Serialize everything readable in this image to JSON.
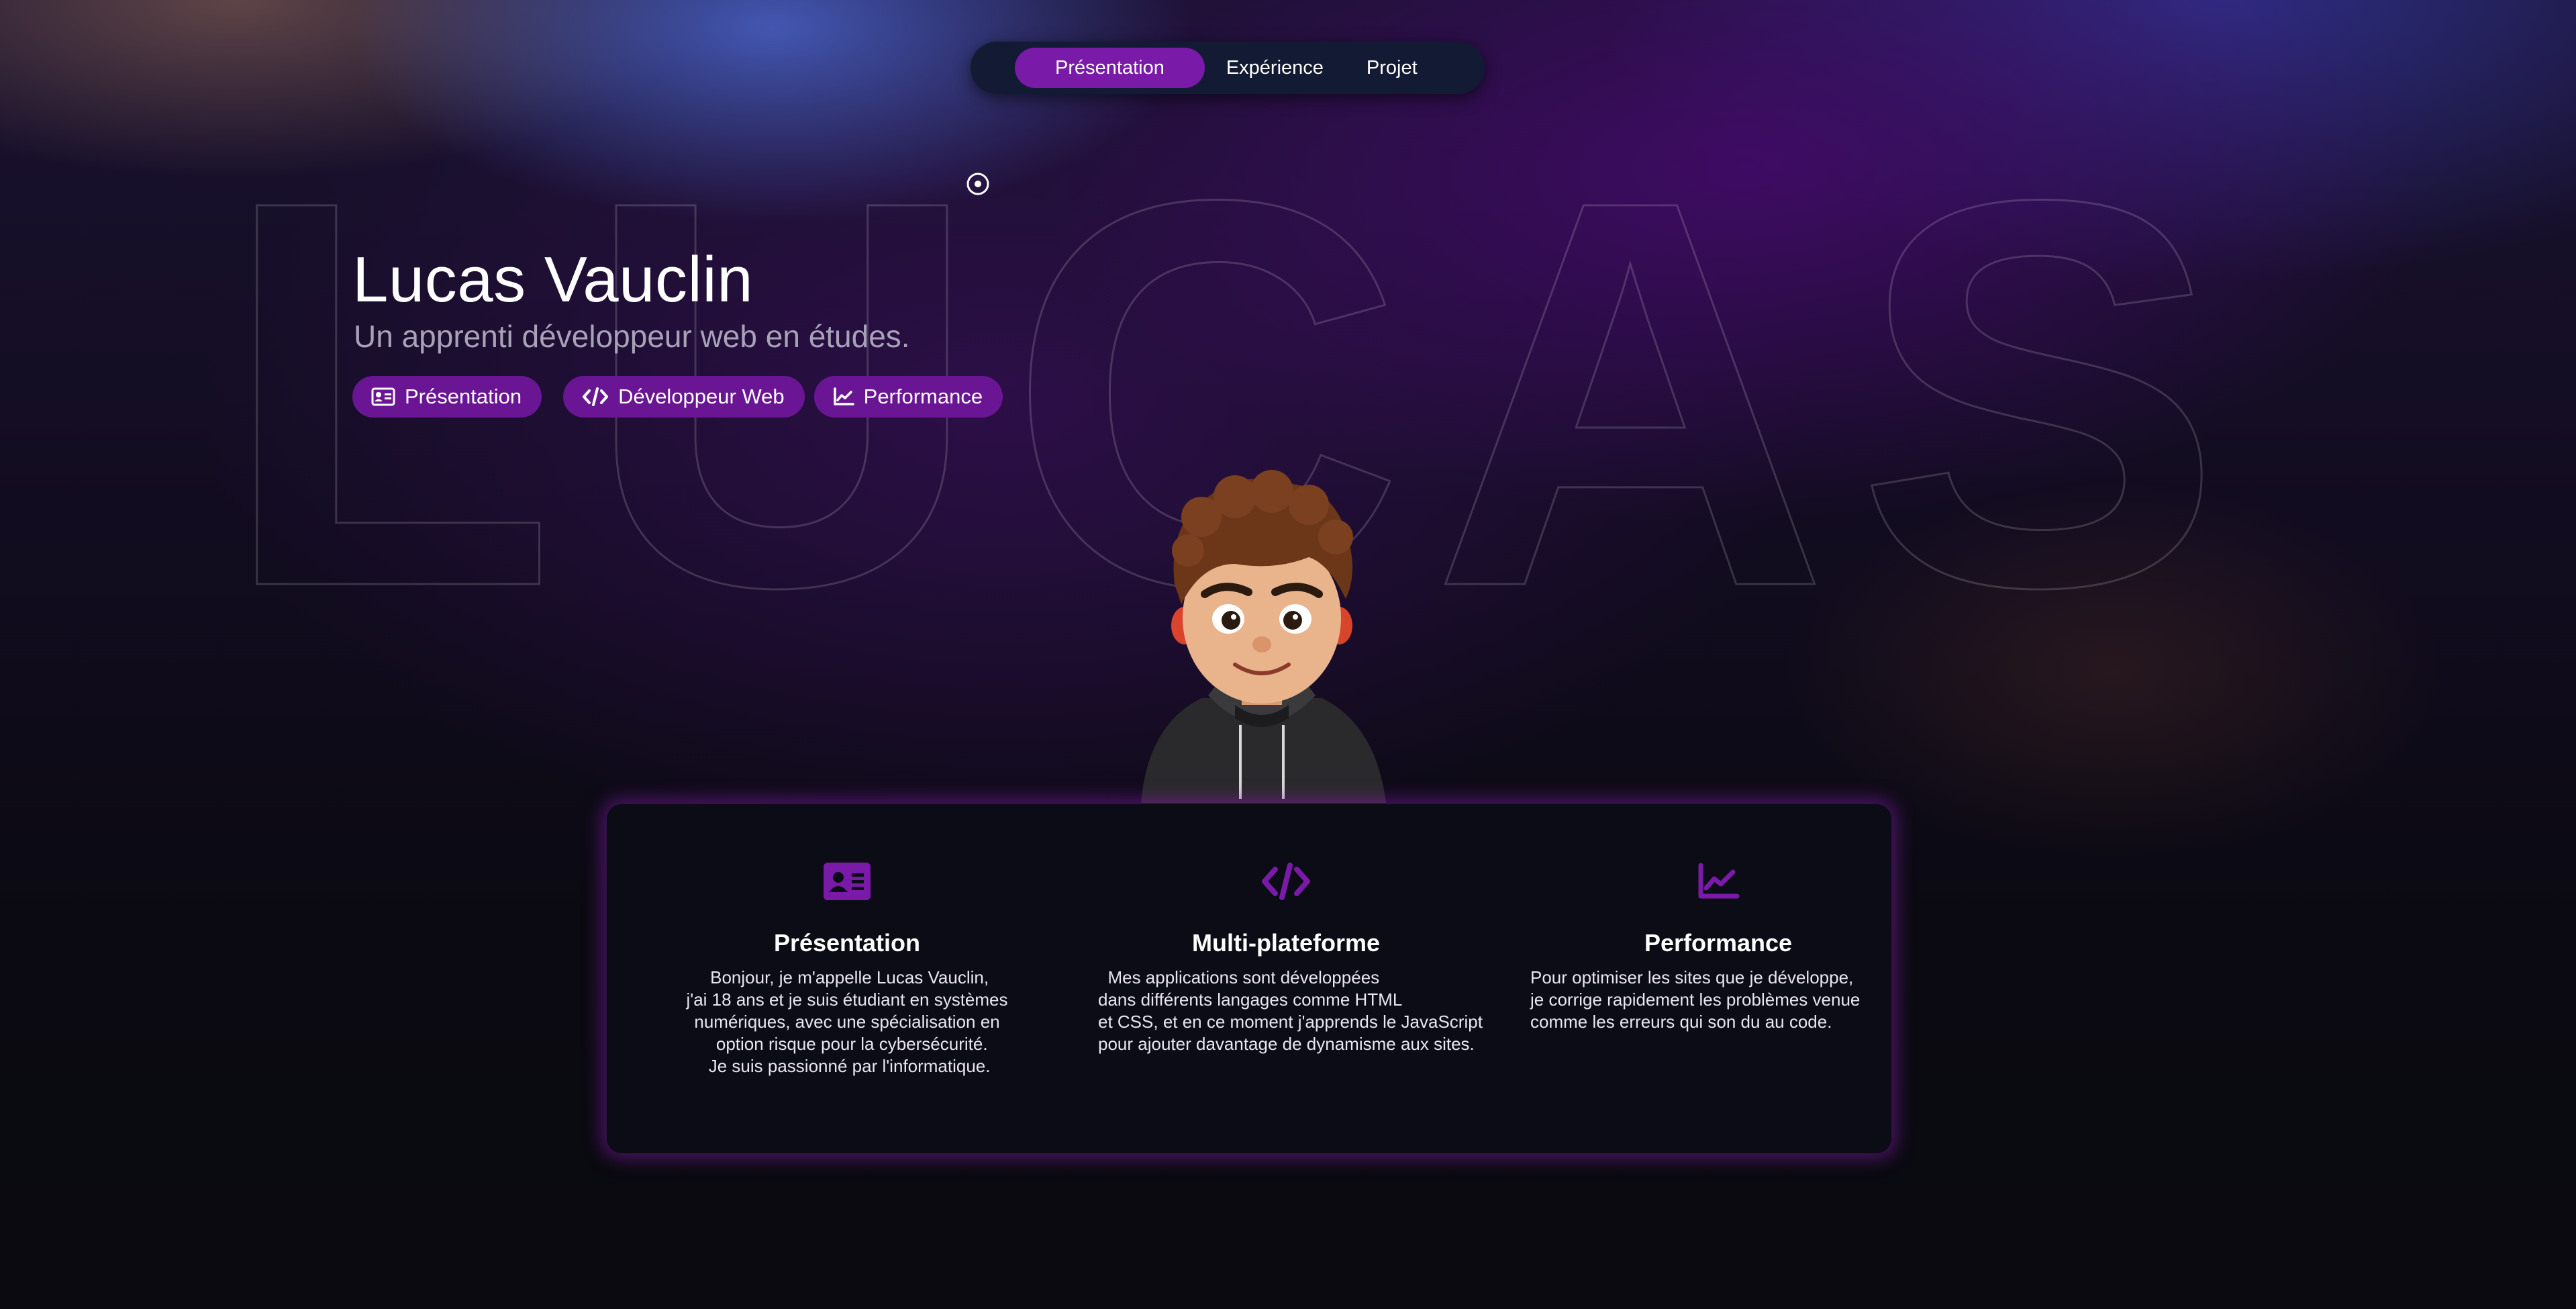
{
  "nav": {
    "items": [
      {
        "label": "Présentation",
        "active": true
      },
      {
        "label": "Expérience",
        "active": false
      },
      {
        "label": "Projet",
        "active": false
      }
    ]
  },
  "background_word": "LUCAS",
  "hero": {
    "name": "Lucas Vauclin",
    "subtitle": "Un apprenti développeur web en études.",
    "pills": [
      {
        "label": "Présentation",
        "icon": "id-card-icon"
      },
      {
        "label": "Développeur Web",
        "icon": "code-icon"
      },
      {
        "label": "Performance",
        "icon": "chart-line-icon"
      }
    ]
  },
  "features": [
    {
      "icon": "id-card-icon",
      "title": "Présentation",
      "text": " Bonjour, je m'appelle Lucas Vauclin,\nj'ai 18 ans et je suis étudiant en systèmes\nnumériques, avec une spécialisation en\n  option risque pour la cybersécurité.\n Je suis passionné par l'informatique."
    },
    {
      "icon": "code-icon",
      "title": "Multi-plateforme",
      "text": "  Mes applications sont développées\ndans différents langages comme HTML\net CSS, et en ce moment j'apprends le JavaScript\npour ajouter davantage de dynamisme aux sites."
    },
    {
      "icon": "chart-line-icon",
      "title": "Performance",
      "text": "Pour optimiser les sites que je développe,\nje corrige rapidement les problèmes venue\ncomme les erreurs qui son du au code."
    }
  ],
  "colors": {
    "accent": "#7a1aa8",
    "pill": "#6a1694",
    "nav_bg": "#131a33",
    "card_bg": "#0c0c16"
  }
}
